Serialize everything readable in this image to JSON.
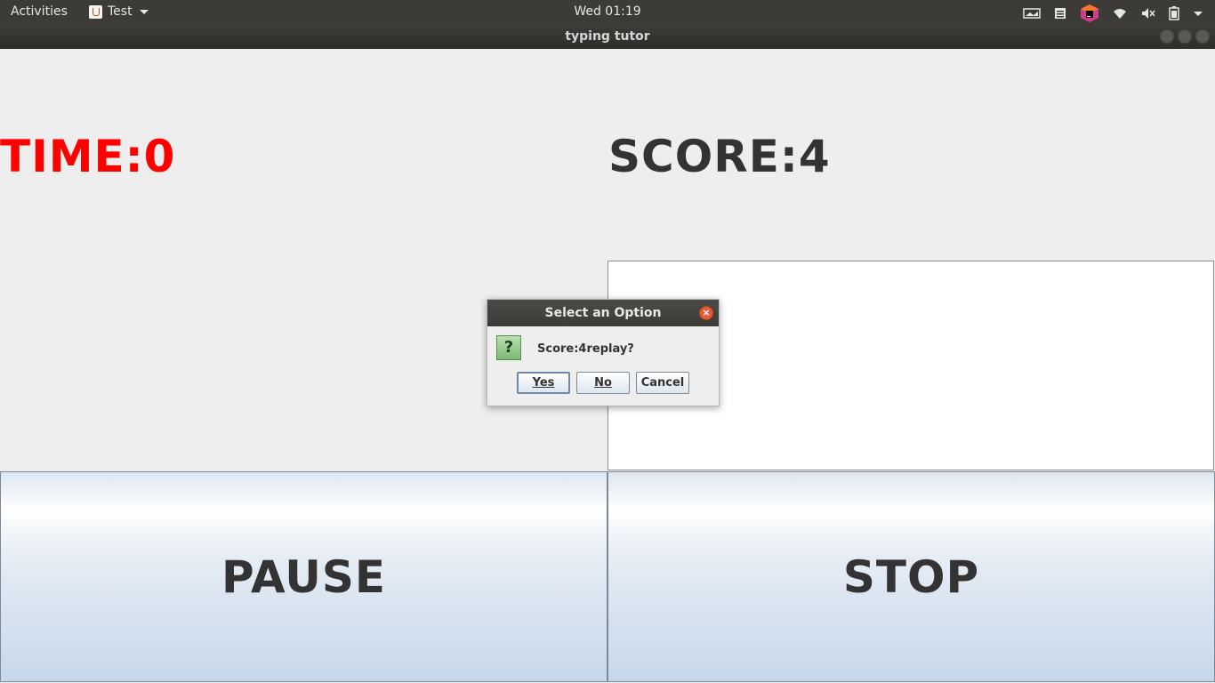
{
  "topbar": {
    "activities": "Activities",
    "app_name": "Test",
    "clock": "Wed 01:19",
    "tray_icons": [
      "screen-icon",
      "notes-icon",
      "jetbrains-icon",
      "wifi-icon",
      "volume-muted-icon",
      "battery-icon",
      "system-menu-caret-icon"
    ]
  },
  "window": {
    "title": "typing tutor"
  },
  "game": {
    "time_label": "TIME:0",
    "score_label": "SCORE:4",
    "typing_value": "",
    "pause_label": "PAUSE",
    "stop_label": "STOP",
    "time_color": "#ff0000"
  },
  "dialog": {
    "title": "Select an Option",
    "message": "Score:4replay?",
    "icon": "question-icon",
    "icon_glyph": "?",
    "buttons": {
      "yes": "Yes",
      "no": "No",
      "cancel": "Cancel"
    }
  }
}
